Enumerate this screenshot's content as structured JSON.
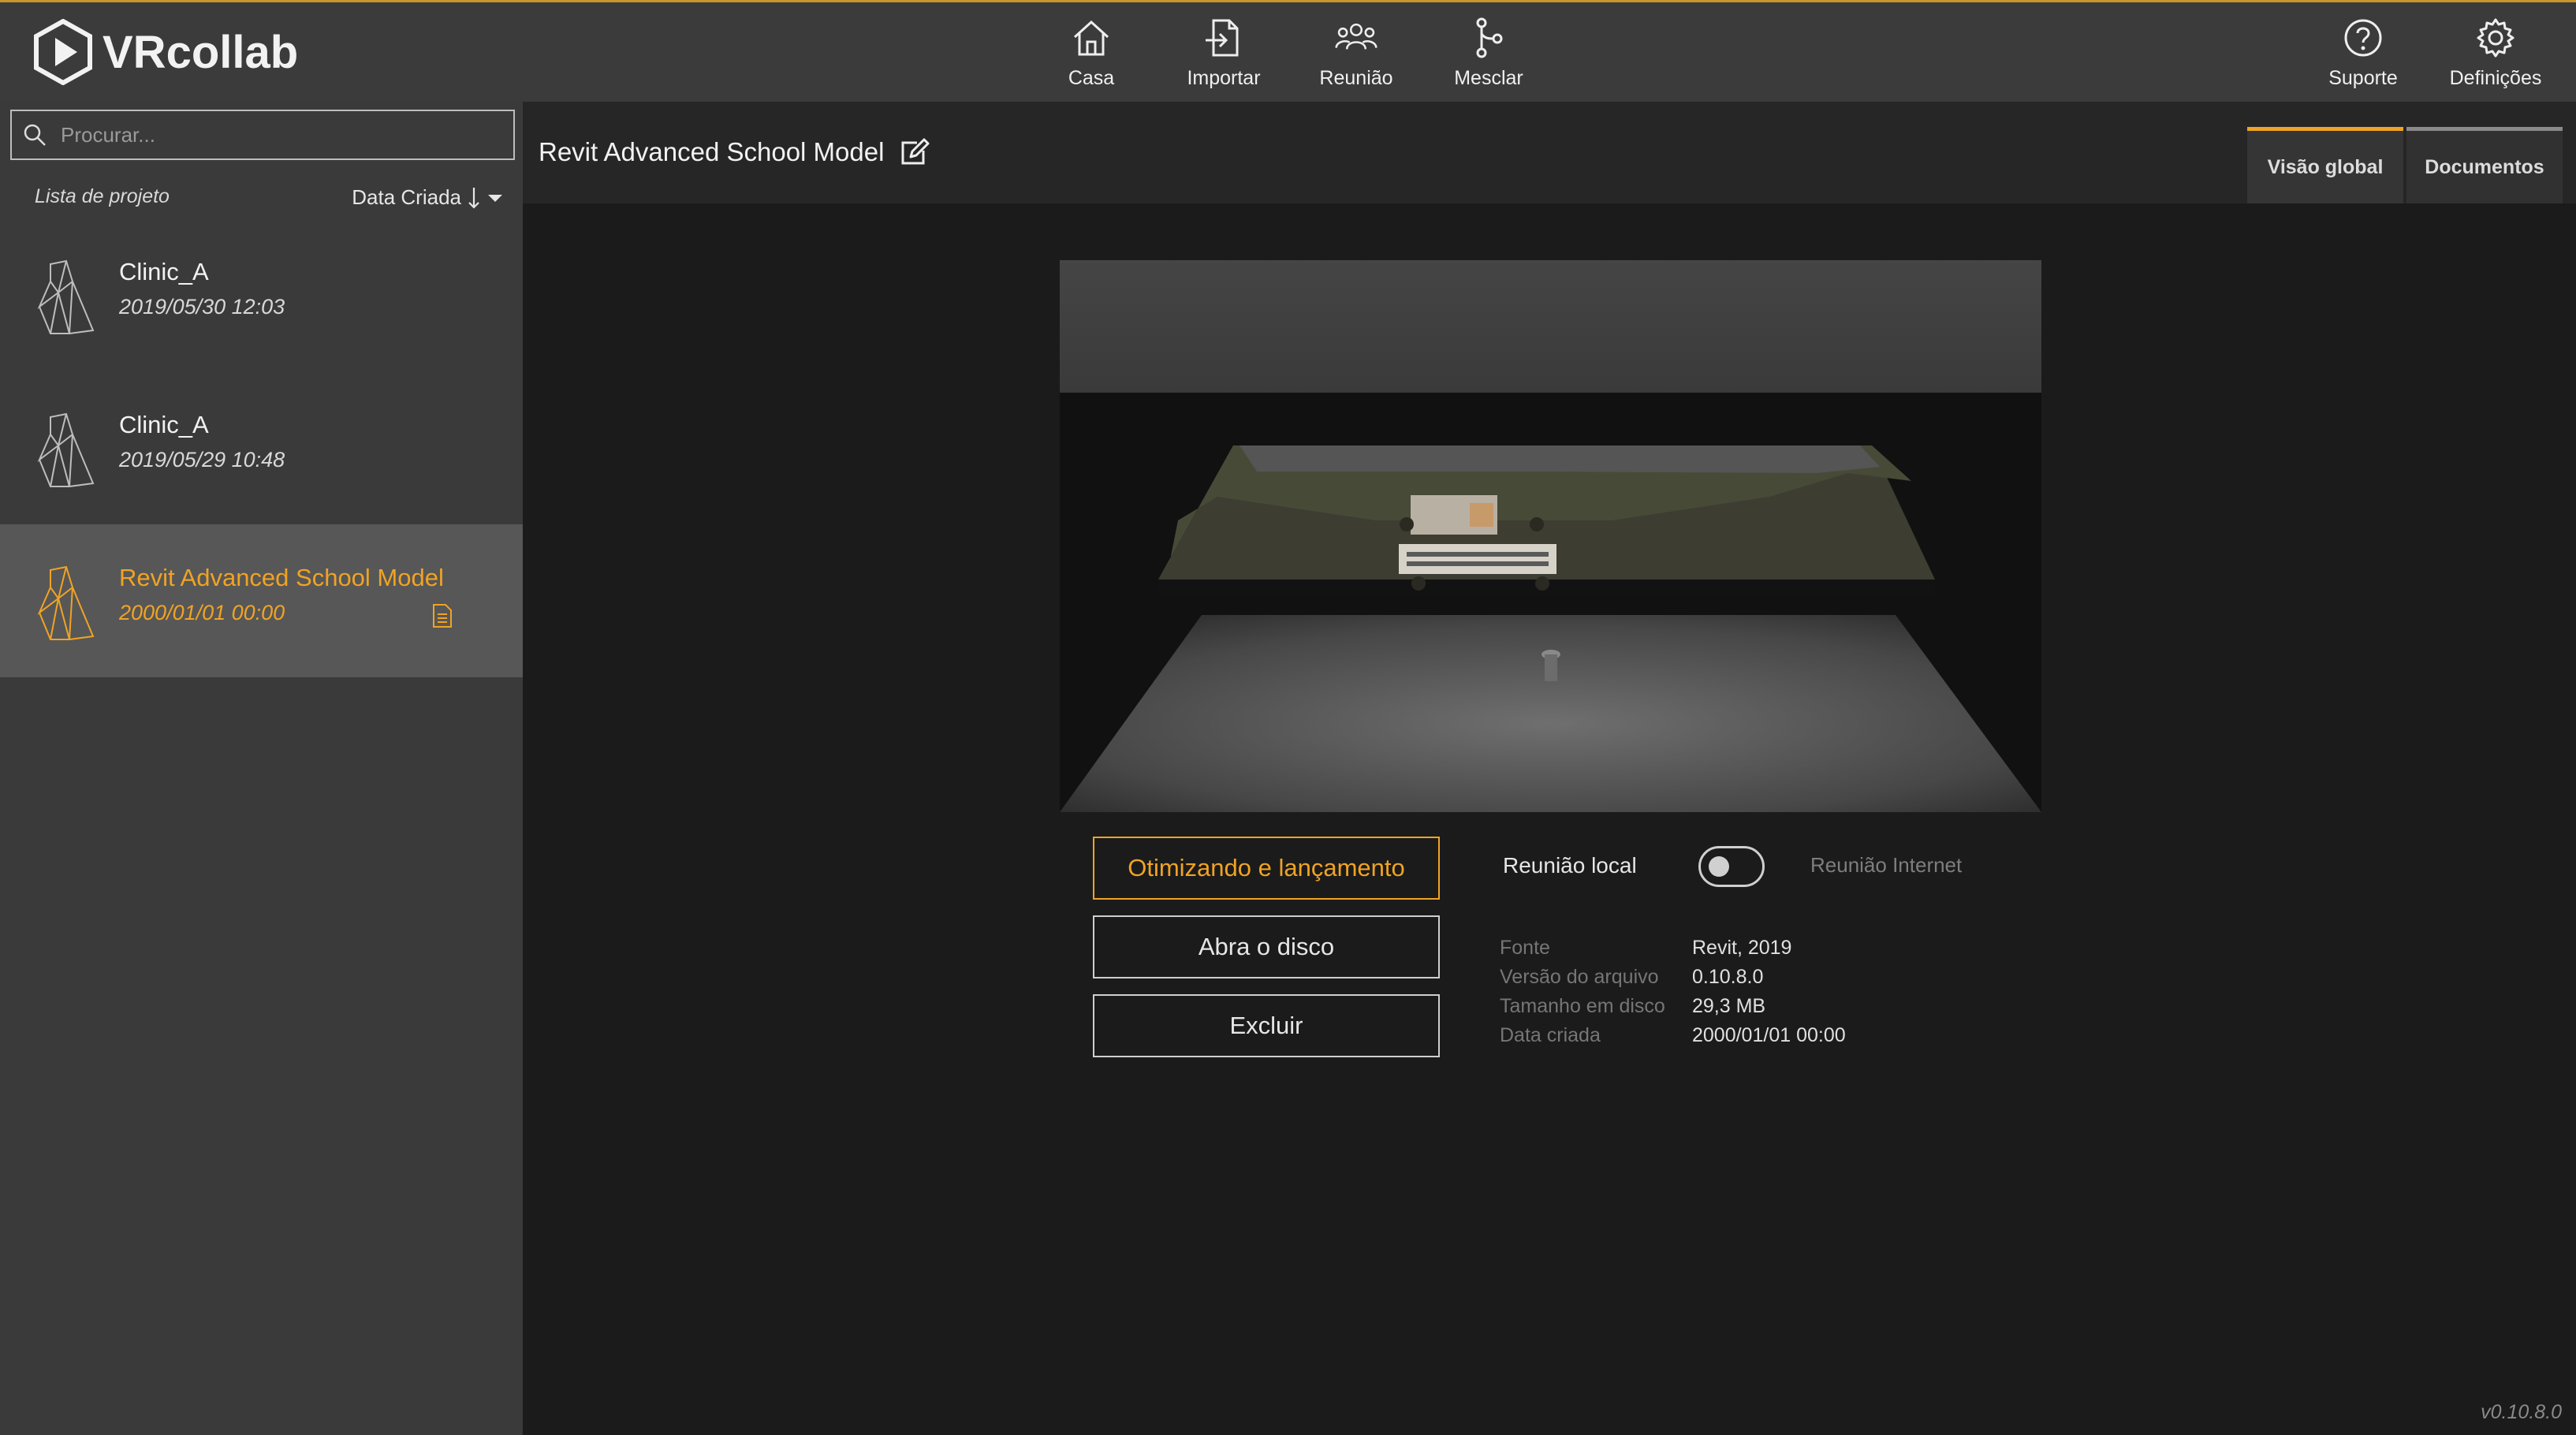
{
  "app": {
    "name": "VRcollab"
  },
  "nav": {
    "home": "Casa",
    "import": "Importar",
    "meeting": "Reunião",
    "merge": "Mesclar",
    "support": "Suporte",
    "settings": "Definições"
  },
  "sidebar": {
    "search_placeholder": "Procurar...",
    "list_title": "Lista de projeto",
    "sort_label": "Data Criada",
    "projects": [
      {
        "name": "Clinic_A",
        "date": "2019/05/30 12:03",
        "icon": "revit-icon",
        "selected": false
      },
      {
        "name": "Clinic_A",
        "date": "2019/05/29 10:48",
        "icon": "revit-icon",
        "selected": false
      },
      {
        "name": "Revit Advanced School Model",
        "date": "2000/01/01 00:00",
        "icon": "revit-icon",
        "selected": true,
        "has_document": true
      }
    ]
  },
  "main": {
    "title": "Revit Advanced School Model",
    "tabs": [
      {
        "label": "Visão global",
        "active": true
      },
      {
        "label": "Documentos",
        "active": false
      }
    ],
    "actions": {
      "launch": "Otimizando e lançamento",
      "open_disk": "Abra o disco",
      "delete": "Excluir"
    },
    "meeting": {
      "local_label": "Reunião local",
      "internet_label": "Reunião Internet",
      "internet_enabled": false
    },
    "info": {
      "source_label": "Fonte",
      "source_value": "Revit, 2019",
      "file_version_label": "Versão do arquivo",
      "file_version_value": "0.10.8.0",
      "disk_size_label": "Tamanho em disco",
      "disk_size_value": "29,3 MB",
      "created_label": "Data criada",
      "created_value": "2000/01/01 00:00"
    }
  },
  "footer": {
    "version": "v0.10.8.0"
  },
  "colors": {
    "accent": "#f0a324",
    "topbar": "#3b3b3b",
    "sidebar": "#3a3a3a",
    "background": "#1b1b1b"
  }
}
